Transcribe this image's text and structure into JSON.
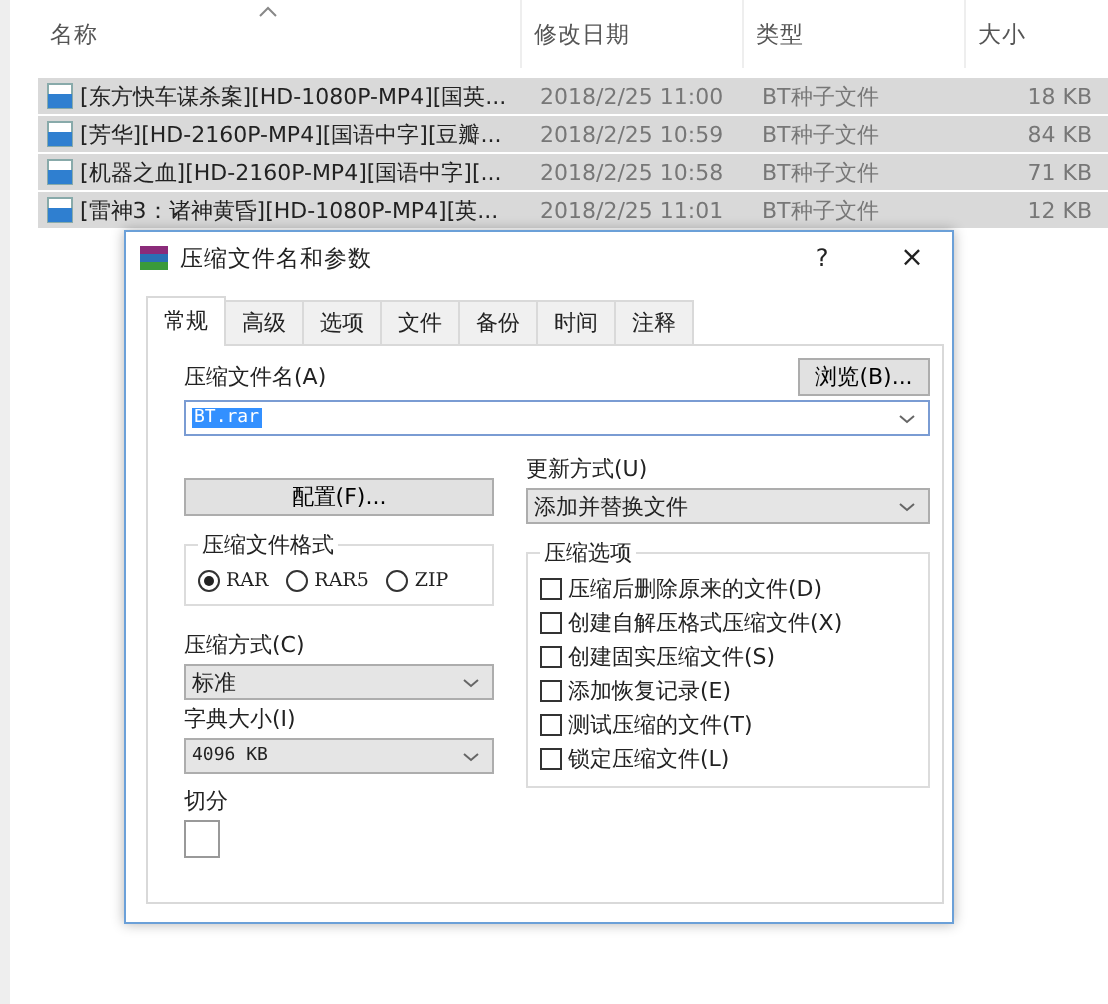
{
  "explorer": {
    "columns": [
      "名称",
      "修改日期",
      "类型",
      "大小"
    ],
    "rows": [
      {
        "name": "[东方快车谋杀案][HD-1080P-MP4][国英...",
        "date": "2018/2/25 11:00",
        "type": "BT种子文件",
        "size": "18 KB",
        "selected": true
      },
      {
        "name": "[芳华][HD-2160P-MP4][国语中字][豆瓣...",
        "date": "2018/2/25 10:59",
        "type": "BT种子文件",
        "size": "84 KB",
        "selected": true
      },
      {
        "name": "[机器之血][HD-2160P-MP4][国语中字][...",
        "date": "2018/2/25 10:58",
        "type": "BT种子文件",
        "size": "71 KB",
        "selected": true
      },
      {
        "name": "[雷神3：诸神黄昏][HD-1080P-MP4][英...",
        "date": "2018/2/25 11:01",
        "type": "BT种子文件",
        "size": "12 KB",
        "selected": true
      }
    ]
  },
  "dialog": {
    "title": "压缩文件名和参数",
    "help": "?",
    "close": "×",
    "tabs": [
      {
        "label": "常规",
        "selected": true
      },
      {
        "label": "高级",
        "selected": false
      },
      {
        "label": "选项",
        "selected": false
      },
      {
        "label": "文件",
        "selected": false
      },
      {
        "label": "备份",
        "selected": false
      },
      {
        "label": "时间",
        "selected": false
      },
      {
        "label": "注释",
        "selected": false
      }
    ],
    "archive_name_label": "压缩文件名(A)",
    "browse_button": "浏览(B)...",
    "archive_name": "BT.rar",
    "update_label": "更新方式(U)",
    "profiles_button": "配置(F)...",
    "update_mode": "添加并替换文件",
    "format_group": {
      "title": "压缩文件格式",
      "options": [
        {
          "label": "RAR",
          "selected": true
        },
        {
          "label": "RAR5",
          "selected": false
        },
        {
          "label": "ZIP",
          "selected": false
        }
      ]
    },
    "method_label": "压缩方式(C)",
    "method": "标准",
    "dict_label": "字典大小(I)",
    "dict": "4096 KB",
    "options_group": {
      "title": "压缩选项",
      "options": [
        {
          "label": "压缩后删除原来的文件(D)",
          "checked": false
        },
        {
          "label": "创建自解压格式压缩文件(X)",
          "checked": false
        },
        {
          "label": "创建固实压缩文件(S)",
          "checked": false
        },
        {
          "label": "添加恢复记录(E)",
          "checked": false
        },
        {
          "label": "测试压缩的文件(T)",
          "checked": false
        },
        {
          "label": "锁定压缩文件(L)",
          "checked": false
        }
      ]
    },
    "split_label": "切分"
  }
}
